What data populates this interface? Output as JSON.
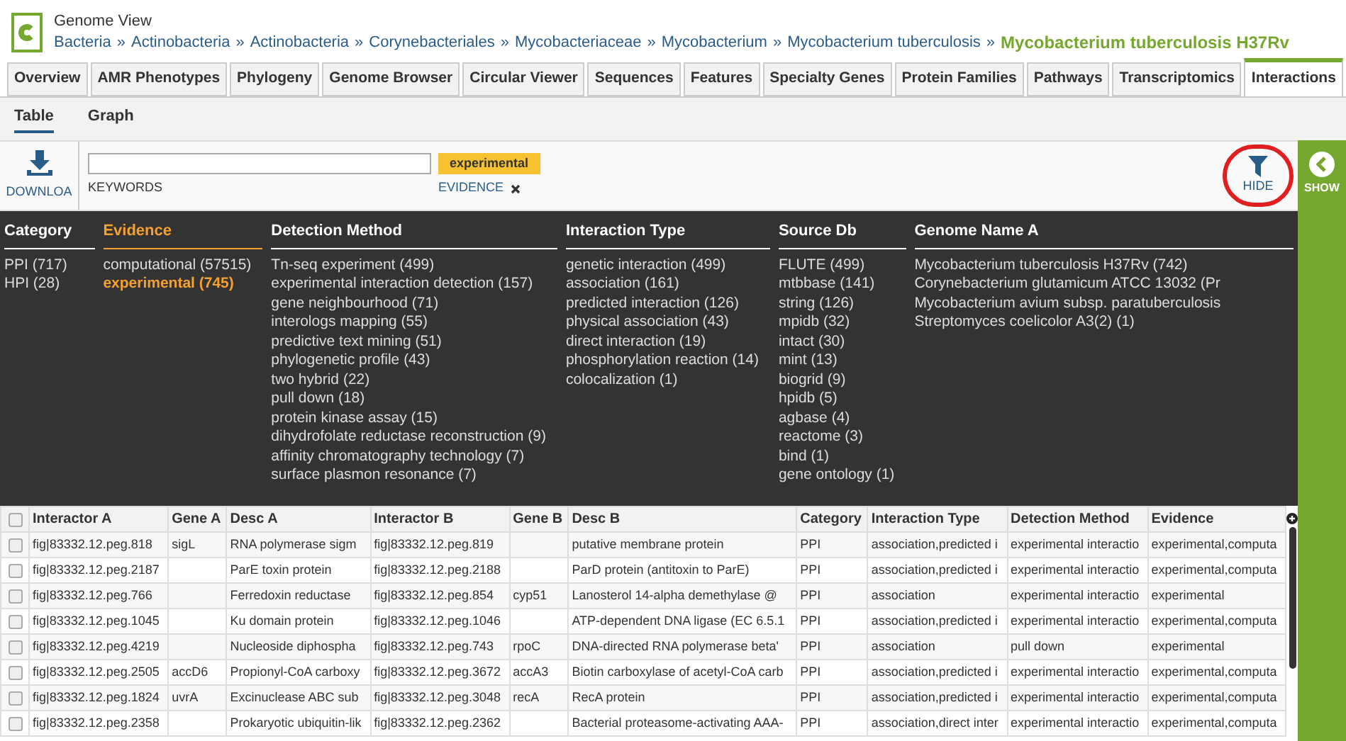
{
  "header": {
    "app_title": "Genome View",
    "breadcrumbs": [
      "Bacteria",
      "Actinobacteria",
      "Actinobacteria",
      "Corynebacteriales",
      "Mycobacteriaceae",
      "Mycobacterium",
      "Mycobacterium tuberculosis"
    ],
    "separator": "»",
    "current": "Mycobacterium tuberculosis H37Rv"
  },
  "tabs": [
    {
      "label": "Overview",
      "selected": false
    },
    {
      "label": "AMR Phenotypes",
      "selected": false
    },
    {
      "label": "Phylogeny",
      "selected": false
    },
    {
      "label": "Genome Browser",
      "selected": false
    },
    {
      "label": "Circular Viewer",
      "selected": false
    },
    {
      "label": "Sequences",
      "selected": false
    },
    {
      "label": "Features",
      "selected": false
    },
    {
      "label": "Specialty Genes",
      "selected": false
    },
    {
      "label": "Protein Families",
      "selected": false
    },
    {
      "label": "Pathways",
      "selected": false
    },
    {
      "label": "Transcriptomics",
      "selected": false
    },
    {
      "label": "Interactions",
      "selected": true
    }
  ],
  "subtabs": [
    {
      "label": "Table",
      "selected": true
    },
    {
      "label": "Graph",
      "selected": false
    }
  ],
  "toolbar": {
    "download_label": "DOWNLOA",
    "keyword_label": "KEYWORDS",
    "filter_tag": "experimental",
    "filter_field": "EVIDENCE",
    "hide_label": "HIDE"
  },
  "side_panel": {
    "label": "SHOW"
  },
  "facets": [
    {
      "title": "Category",
      "selected": false,
      "values": [
        {
          "label": "PPI (717)",
          "selected": false
        },
        {
          "label": "HPI (28)",
          "selected": false
        }
      ]
    },
    {
      "title": "Evidence",
      "selected": true,
      "values": [
        {
          "label": "computational (57515)",
          "selected": false
        },
        {
          "label": "experimental (745)",
          "selected": true
        }
      ]
    },
    {
      "title": "Detection Method",
      "selected": false,
      "values": [
        {
          "label": "Tn-seq experiment (499)",
          "selected": false
        },
        {
          "label": "experimental interaction detection (157)",
          "selected": false
        },
        {
          "label": "gene neighbourhood (71)",
          "selected": false
        },
        {
          "label": "interologs mapping (55)",
          "selected": false
        },
        {
          "label": "predictive text mining (51)",
          "selected": false
        },
        {
          "label": "phylogenetic profile (43)",
          "selected": false
        },
        {
          "label": "two hybrid (22)",
          "selected": false
        },
        {
          "label": "pull down (18)",
          "selected": false
        },
        {
          "label": "protein kinase assay (15)",
          "selected": false
        },
        {
          "label": "dihydrofolate reductase reconstruction (9)",
          "selected": false
        },
        {
          "label": "affinity chromatography technology (7)",
          "selected": false
        },
        {
          "label": "surface plasmon resonance (7)",
          "selected": false
        }
      ]
    },
    {
      "title": "Interaction Type",
      "selected": false,
      "values": [
        {
          "label": "genetic interaction (499)",
          "selected": false
        },
        {
          "label": "association (161)",
          "selected": false
        },
        {
          "label": "predicted interaction (126)",
          "selected": false
        },
        {
          "label": "physical association (43)",
          "selected": false
        },
        {
          "label": "direct interaction (19)",
          "selected": false
        },
        {
          "label": "phosphorylation reaction (14)",
          "selected": false
        },
        {
          "label": "colocalization (1)",
          "selected": false
        }
      ]
    },
    {
      "title": "Source Db",
      "selected": false,
      "values": [
        {
          "label": "FLUTE (499)",
          "selected": false
        },
        {
          "label": "mtbbase (141)",
          "selected": false
        },
        {
          "label": "string (126)",
          "selected": false
        },
        {
          "label": "mpidb (32)",
          "selected": false
        },
        {
          "label": "intact (30)",
          "selected": false
        },
        {
          "label": "mint (13)",
          "selected": false
        },
        {
          "label": "biogrid (9)",
          "selected": false
        },
        {
          "label": "hpidb (5)",
          "selected": false
        },
        {
          "label": "agbase (4)",
          "selected": false
        },
        {
          "label": "reactome (3)",
          "selected": false
        },
        {
          "label": "bind (1)",
          "selected": false
        },
        {
          "label": "gene ontology (1)",
          "selected": false
        }
      ]
    },
    {
      "title": "Genome Name A",
      "selected": false,
      "values": [
        {
          "label": "Mycobacterium tuberculosis H37Rv (742)",
          "selected": false
        },
        {
          "label": "Corynebacterium glutamicum ATCC 13032 (Pr",
          "selected": false
        },
        {
          "label": "Mycobacterium avium subsp. paratuberculosis",
          "selected": false
        },
        {
          "label": "Streptomyces coelicolor A3(2) (1)",
          "selected": false
        }
      ]
    }
  ],
  "table": {
    "select_all": {
      "checked": false
    },
    "columns": [
      "Interactor A",
      "Gene A",
      "Desc A",
      "Interactor B",
      "Gene B",
      "Desc B",
      "Category",
      "Interaction Type",
      "Detection Method",
      "Evidence"
    ],
    "rows": [
      {
        "checked": false,
        "cells": [
          "fig|83332.12.peg.818",
          "sigL",
          "RNA polymerase sigm",
          "fig|83332.12.peg.819",
          "",
          "putative membrane protein",
          "PPI",
          "association,predicted i",
          "experimental interactio",
          "experimental,computa"
        ]
      },
      {
        "checked": false,
        "cells": [
          "fig|83332.12.peg.2187",
          "",
          "ParE toxin protein",
          "fig|83332.12.peg.2188",
          "",
          "ParD protein (antitoxin to ParE)",
          "PPI",
          "association,predicted i",
          "experimental interactio",
          "experimental,computa"
        ]
      },
      {
        "checked": false,
        "cells": [
          "fig|83332.12.peg.766",
          "",
          "Ferredoxin reductase",
          "fig|83332.12.peg.854",
          "cyp51",
          "Lanosterol 14-alpha demethylase @",
          "PPI",
          "association",
          "experimental interactio",
          "experimental"
        ]
      },
      {
        "checked": false,
        "cells": [
          "fig|83332.12.peg.1045",
          "",
          "Ku domain protein",
          "fig|83332.12.peg.1046",
          "",
          "ATP-dependent DNA ligase (EC 6.5.1",
          "PPI",
          "association,predicted i",
          "experimental interactio",
          "experimental,computa"
        ]
      },
      {
        "checked": false,
        "cells": [
          "fig|83332.12.peg.4219",
          "",
          "Nucleoside diphospha",
          "fig|83332.12.peg.743",
          "rpoC",
          "DNA-directed RNA polymerase beta'",
          "PPI",
          "association",
          "pull down",
          "experimental"
        ]
      },
      {
        "checked": false,
        "cells": [
          "fig|83332.12.peg.2505",
          "accD6",
          "Propionyl-CoA carboxy",
          "fig|83332.12.peg.3672",
          "accA3",
          "Biotin carboxylase of acetyl-CoA carb",
          "PPI",
          "association,predicted i",
          "experimental interactio",
          "experimental,computa"
        ]
      },
      {
        "checked": false,
        "cells": [
          "fig|83332.12.peg.1824",
          "uvrA",
          "Excinuclease ABC sub",
          "fig|83332.12.peg.3048",
          "recA",
          "RecA protein",
          "PPI",
          "association,predicted i",
          "experimental interactio",
          "experimental,computa"
        ]
      },
      {
        "checked": false,
        "cells": [
          "fig|83332.12.peg.2358",
          "",
          "Prokaryotic ubiquitin-lik",
          "fig|83332.12.peg.2362",
          "",
          "Bacterial proteasome-activating AAA-",
          "PPI",
          "association,direct inter",
          "experimental interactio",
          "experimental,computa"
        ]
      }
    ]
  }
}
